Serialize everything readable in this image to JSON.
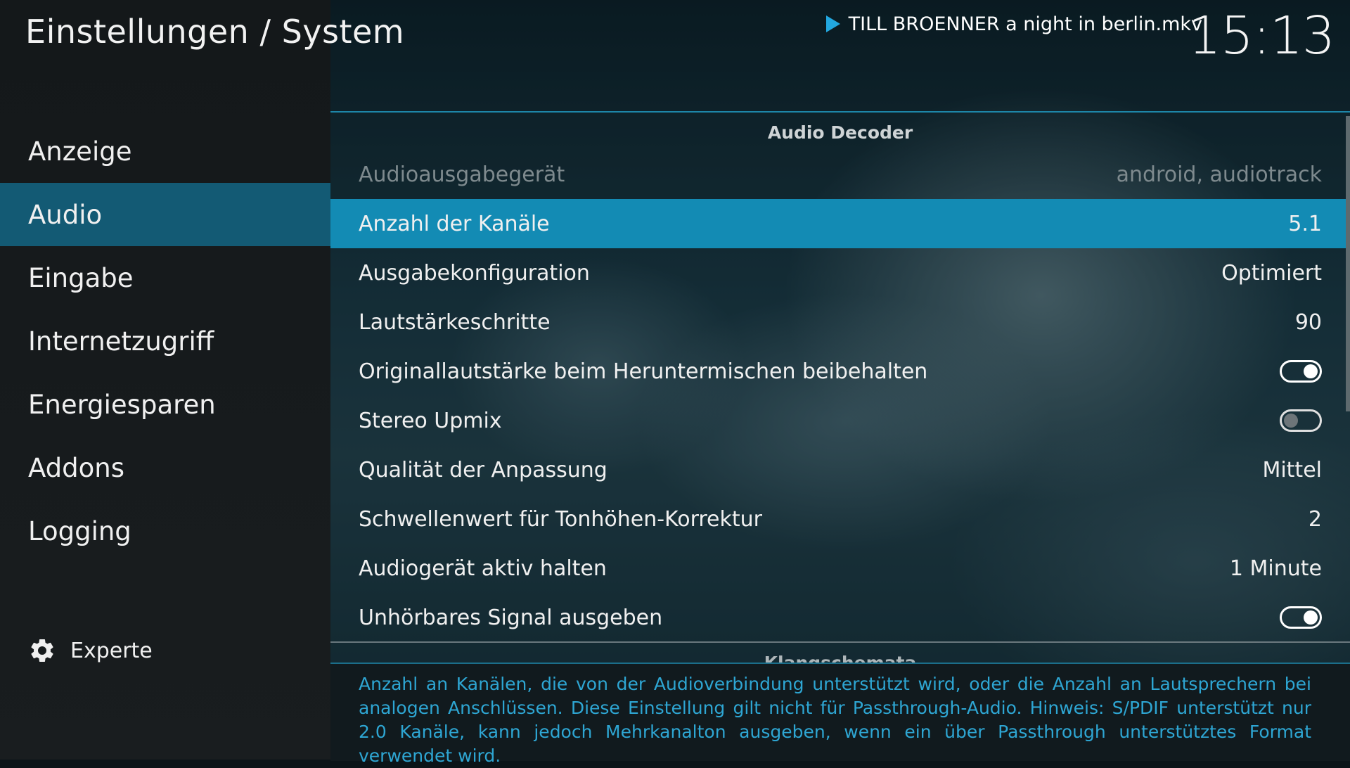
{
  "header": {
    "title": "Einstellungen / System",
    "now_playing": "TILL BROENNER a night in berlin.mkv",
    "clock": "15:13"
  },
  "sidebar": {
    "items": [
      {
        "label": "Anzeige"
      },
      {
        "label": "Audio"
      },
      {
        "label": "Eingabe"
      },
      {
        "label": "Internetzugriff"
      },
      {
        "label": "Energiesparen"
      },
      {
        "label": "Addons"
      },
      {
        "label": "Logging"
      }
    ],
    "active_index": 1,
    "level_label": "Experte",
    "level_icon": "gear-icon"
  },
  "main": {
    "section_title": "Audio Decoder",
    "settings": [
      {
        "label": "Audioausgabegerät",
        "value": "android, audiotrack",
        "state": "disabled"
      },
      {
        "label": "Anzahl der Kanäle",
        "value": "5.1",
        "state": "focused"
      },
      {
        "label": "Ausgabekonfiguration",
        "value": "Optimiert"
      },
      {
        "label": "Lautstärkeschritte",
        "value": "90"
      },
      {
        "label": "Originallautstärke beim Heruntermischen beibehalten",
        "toggle": "on"
      },
      {
        "label": "Stereo Upmix",
        "toggle": "off"
      },
      {
        "label": "Qualität der Anpassung",
        "value": "Mittel"
      },
      {
        "label": "Schwellenwert für Tonhöhen-Korrektur",
        "value": "2"
      },
      {
        "label": "Audiogerät aktiv halten",
        "value": "1 Minute"
      },
      {
        "label": "Unhörbares Signal ausgeben",
        "toggle": "on"
      }
    ],
    "next_section_title": "Klangschemata",
    "description": "Anzahl an Kanälen, die von der Audioverbindung unterstützt wird, oder die Anzahl an Lautsprechern bei analogen Anschlüssen. Diese Einstellung gilt nicht für Passthrough-Audio. Hinweis: S/PDIF unterstützt nur 2.0 Kanäle, kann jedoch Mehrkanalton ausgeben, wenn ein über Passthrough unterstütztes Format verwendet wird."
  },
  "colors": {
    "accent": "#138bb4",
    "sidebar_active": "#135a74",
    "description_text": "#2ea6d3"
  }
}
